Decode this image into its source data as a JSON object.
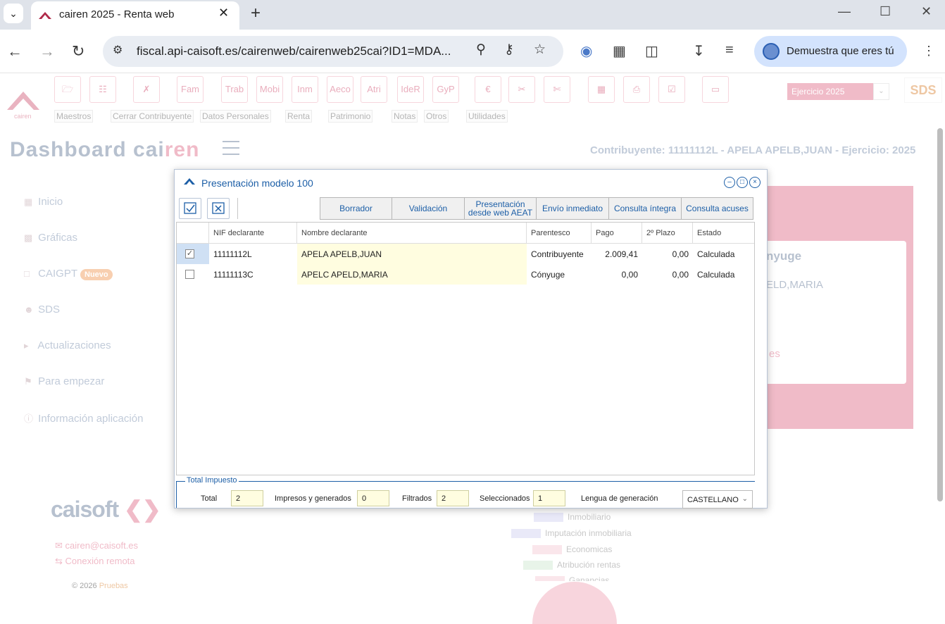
{
  "browser": {
    "tab_title": "cairen 2025 - Renta web",
    "url": "fiscal.api-caisoft.es/cairenweb/cairenweb25cai?ID1=MDA...",
    "profile_label": "Demuestra que eres tú"
  },
  "ribbon": {
    "buttons": [
      "Fam",
      "Trab",
      "Mobi",
      "Inm",
      "Aeco",
      "Atri",
      "IdeR",
      "GyP"
    ],
    "menus": [
      "Maestros",
      "Cerrar Contribuyente",
      "Datos Personales",
      "Renta",
      "Patrimonio",
      "Notas",
      "Otros",
      "Utilidades"
    ],
    "ejercicio": "Ejercicio 2025",
    "logo_text": "cairen",
    "sds_logo": "SDS"
  },
  "header": {
    "title_main": "Dashboard cai",
    "title_accent": "ren",
    "contribuyente": "Contribuyente: 11111112L - APELA APELB,JUAN - Ejercicio: 2025"
  },
  "sidebar": {
    "items": [
      {
        "label": "Inicio",
        "icon": "grid-icon"
      },
      {
        "label": "Gráficas",
        "icon": "chart-icon"
      },
      {
        "label": "CAIGPT",
        "icon": "chat-icon",
        "badge": "Nuevo"
      },
      {
        "label": "SDS",
        "icon": "user-icon"
      },
      {
        "label": "Actualizaciones",
        "icon": "megaphone-icon"
      },
      {
        "label": "Para empezar",
        "icon": "flag-icon"
      },
      {
        "label": "Información aplicación",
        "icon": "info-icon"
      }
    ],
    "brand_a": "caisoft",
    "email": "cairen@caisoft.es",
    "remote": "Conexión remota",
    "copyright": "© 2026",
    "copyright_accent": "Pruebas"
  },
  "background_card": {
    "title_fragment": "nyuge",
    "name_fragment": "ELD,MARIA",
    "link_fragment": "es"
  },
  "chart_legend": [
    "Inmobiliario",
    "Imputación inmobiliaria",
    "Economicas",
    "Atribución rentas",
    "Ganancias"
  ],
  "colors": {
    "accent": "#e4839b",
    "modal_blue": "#1d5fa7",
    "row_yellow": "#fffde0"
  },
  "modal": {
    "title": "Presentación modelo 100",
    "buttons": {
      "borrador": "Borrador",
      "validacion": "Validación",
      "presentacion_1": "Presentación",
      "presentacion_2": "desde web AEAT",
      "envio": "Envío inmediato",
      "consulta_integra": "Consulta íntegra",
      "consulta_acuses": "Consulta acuses"
    },
    "columns": [
      "NIF declarante",
      "Nombre declarante",
      "Parentesco",
      "Pago",
      "2º Plazo",
      "Estado"
    ],
    "rows": [
      {
        "checked": true,
        "nif": "11111112L",
        "nombre": "APELA APELB,JUAN",
        "parentesco": "Contribuyente",
        "pago": "2.009,41",
        "plazo2": "0,00",
        "estado": "Calculada"
      },
      {
        "checked": false,
        "nif": "11111113C",
        "nombre": "APELC APELD,MARIA",
        "parentesco": "Cónyuge",
        "pago": "0,00",
        "plazo2": "0,00",
        "estado": "Calculada"
      }
    ],
    "footer": {
      "legend": "Total Impuesto",
      "total_label": "Total",
      "total_value": "2",
      "impresos_label": "Impresos y generados",
      "impresos_value": "0",
      "filtrados_label": "Filtrados",
      "filtrados_value": "2",
      "seleccionados_label": "Seleccionados",
      "seleccionados_value": "1",
      "lengua_label": "Lengua de generación",
      "lengua_value": "CASTELLANO"
    }
  }
}
